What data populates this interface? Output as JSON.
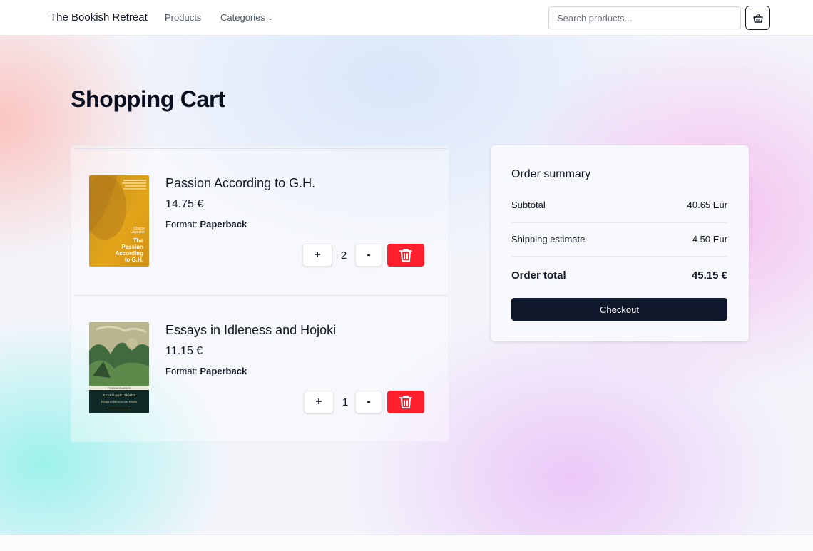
{
  "header": {
    "brand": "The Bookish Retreat",
    "nav": {
      "products": "Products",
      "categories": "Categories"
    },
    "search": {
      "placeholder": "Search products..."
    },
    "cart_icon": "basket-icon"
  },
  "page": {
    "title": "Shopping Cart"
  },
  "cart": {
    "items": [
      {
        "title": "Passion According to G.H.",
        "price": "14.75 €",
        "format_label": "Format:",
        "format": "Paperback",
        "quantity": "2",
        "plus": "+",
        "minus": "-",
        "cover_text": [
          "Clarice Lispector",
          "The Passion According to G.H."
        ],
        "cover_color": "#e0a21a"
      },
      {
        "title": "Essays in Idleness and Hojoki",
        "price": "11.15 €",
        "format_label": "Format:",
        "format": "Paperback",
        "quantity": "1",
        "plus": "+",
        "minus": "-",
        "cover_text": [
          "KENKŌ AND CHŌMEI",
          "PENGUIN CLASSICS",
          "Essays in Idleness and Hōjōki"
        ],
        "cover_color": "#0f2a26"
      }
    ],
    "delete_icon": "trash-icon",
    "delete_color": "#ff1f2d"
  },
  "summary": {
    "title": "Order summary",
    "subtotal_label": "Subtotal",
    "subtotal": "40.65 Eur",
    "shipping_label": "Shipping estimate",
    "shipping": "4.50 Eur",
    "total_label": "Order total",
    "total": "45.15 €",
    "checkout": "Checkout"
  }
}
